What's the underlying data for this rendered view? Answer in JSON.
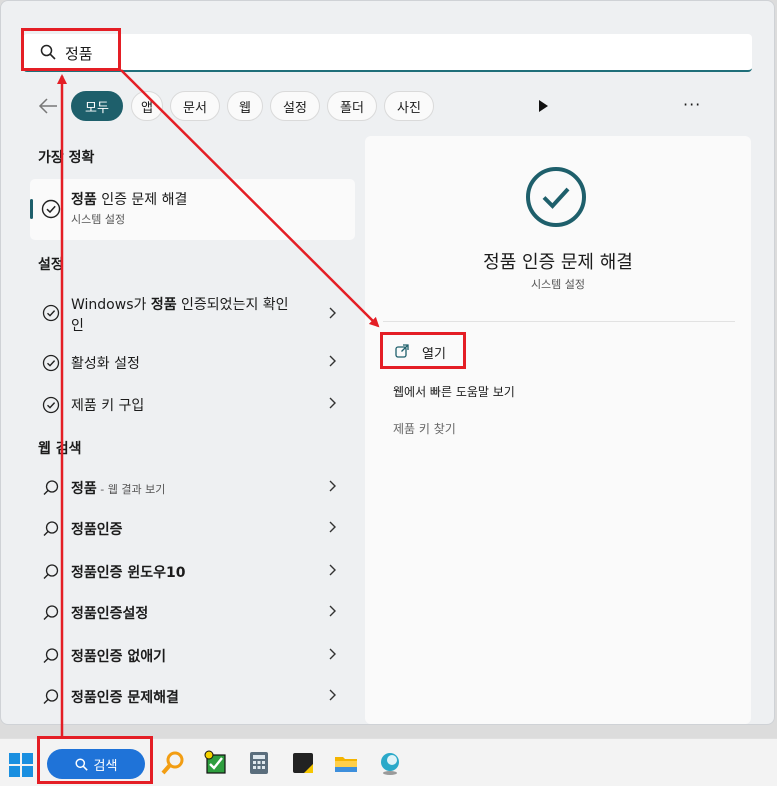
{
  "search": {
    "query": "정품"
  },
  "filters": {
    "back": "back-arrow-icon",
    "chips": [
      "모두",
      "앱",
      "문서",
      "웹",
      "설정",
      "폴더",
      "사진"
    ],
    "more": "···"
  },
  "best_match": {
    "section": "가장 정확",
    "title_bold": "정품",
    "title_rest": " 인증 문제 해결",
    "subtitle": "시스템 설정"
  },
  "settings": {
    "section": "설정",
    "items": [
      {
        "pre": "Windows가 ",
        "bold": "정품",
        "post": " 인증되었는지 확인",
        "line2": "인"
      },
      {
        "pre": "활성화 설정",
        "bold": "",
        "post": ""
      },
      {
        "pre": "제품 키 구입",
        "bold": "",
        "post": ""
      }
    ]
  },
  "web": {
    "section": "웹 검색",
    "items": [
      {
        "text": "정품",
        "sub": " - 웹 결과 보기"
      },
      {
        "text": "정품인증",
        "sub": ""
      },
      {
        "text": "정품인증 윈도우10",
        "sub": ""
      },
      {
        "text": "정품인증설정",
        "sub": ""
      },
      {
        "text": "정품인증 없애기",
        "sub": ""
      },
      {
        "text": "정품인증 문제해결",
        "sub": ""
      }
    ]
  },
  "detail": {
    "title": "정품 인증 문제 해결",
    "subtitle": "시스템 설정",
    "actions": [
      "열기",
      "웹에서 빠른 도움말 보기",
      "제품 키 찾기"
    ]
  },
  "taskbar": {
    "search_label": "검색"
  },
  "colors": {
    "accent": "#1e5f6b",
    "annotation": "#e41e25",
    "taskbar_search": "#1f73d8"
  }
}
